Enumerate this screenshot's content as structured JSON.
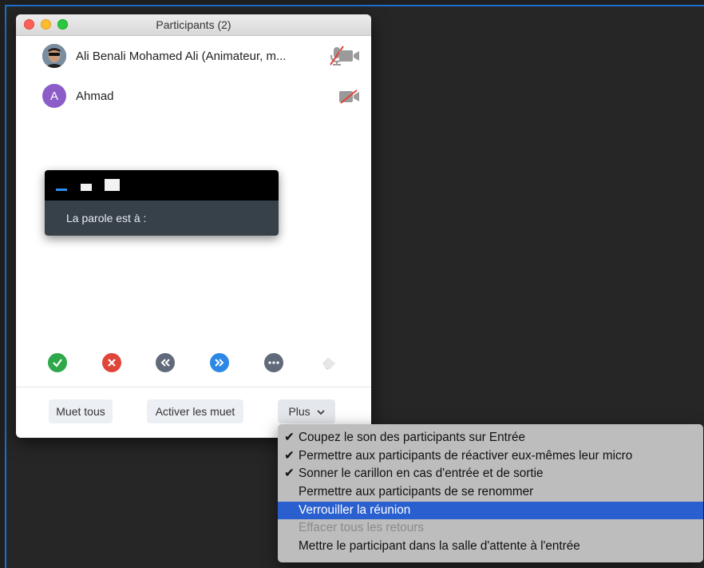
{
  "window": {
    "title": "Participants (2)"
  },
  "participants": [
    {
      "name": "Ali Benali Mohamed Ali (Animateur, m...",
      "avatar": "photo",
      "mic": "muted",
      "video": "on"
    },
    {
      "name": "Ahmad",
      "avatar_letter": "A",
      "avatar_color": "#8c5cc8",
      "video": "off"
    }
  ],
  "speaker_box": {
    "label": "La parole est à :"
  },
  "reactions": [
    {
      "icon": "check-icon",
      "color": "#2ea84a"
    },
    {
      "icon": "x-icon",
      "color": "#e0453a"
    },
    {
      "icon": "slower-icon",
      "color": "#606a7a"
    },
    {
      "icon": "faster-icon",
      "color": "#2d87e6"
    },
    {
      "icon": "more-icon",
      "color": "#606a7a"
    },
    {
      "icon": "eraser-icon",
      "color": "#e0e0e0"
    }
  ],
  "buttons": {
    "mute_all": "Muet tous",
    "unmute_all": "Activer les muet",
    "more": "Plus"
  },
  "menu": {
    "items": [
      {
        "label": "Coupez le son des participants sur Entrée",
        "checked": true
      },
      {
        "label": "Permettre aux participants de réactiver eux-mêmes leur micro",
        "checked": true
      },
      {
        "label": "Sonner le carillon en cas d'entrée et de sortie",
        "checked": true
      },
      {
        "label": "Permettre aux participants de se renommer",
        "checked": false
      },
      {
        "label": "Verrouiller la réunion",
        "checked": false,
        "selected": true
      },
      {
        "label": "Effacer tous les retours",
        "checked": false,
        "disabled": true
      },
      {
        "label": "Mettre le participant dans la salle d'attente à l'entrée",
        "checked": false
      }
    ]
  },
  "colors": {
    "menu_highlight": "#2a5fcf",
    "desktop_border": "#1b6ed1"
  }
}
